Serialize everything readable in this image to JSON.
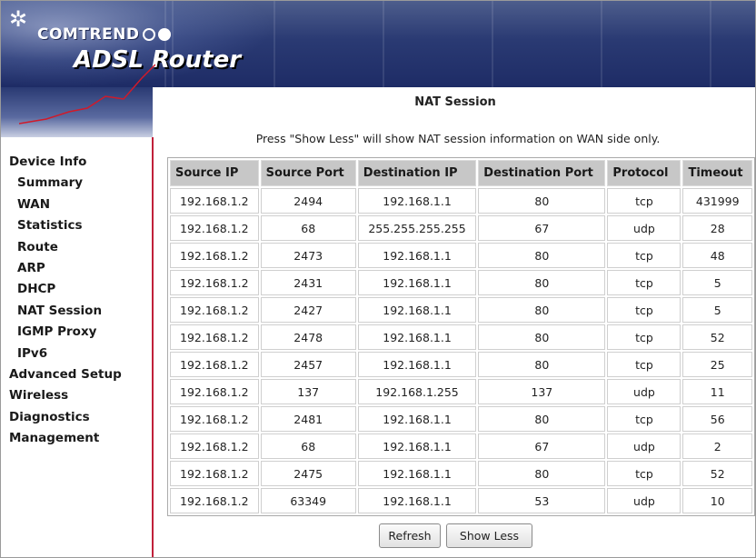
{
  "header": {
    "brand": "COMTREND",
    "product": "ADSL Router",
    "logo_icon": "snowflake-logo-icon"
  },
  "sidebar": {
    "items": [
      {
        "label": "Device Info",
        "level": "top"
      },
      {
        "label": "Summary",
        "level": "sub"
      },
      {
        "label": "WAN",
        "level": "sub"
      },
      {
        "label": "Statistics",
        "level": "sub"
      },
      {
        "label": "Route",
        "level": "sub"
      },
      {
        "label": "ARP",
        "level": "sub"
      },
      {
        "label": "DHCP",
        "level": "sub"
      },
      {
        "label": "NAT Session",
        "level": "sub"
      },
      {
        "label": "IGMP Proxy",
        "level": "sub"
      },
      {
        "label": "IPv6",
        "level": "sub"
      },
      {
        "label": "Advanced Setup",
        "level": "top"
      },
      {
        "label": "Wireless",
        "level": "top"
      },
      {
        "label": "Diagnostics",
        "level": "top"
      },
      {
        "label": "Management",
        "level": "top"
      }
    ]
  },
  "main": {
    "title": "NAT Session",
    "note": "Press \"Show Less\" will show NAT session information on WAN side only.",
    "table": {
      "headers": [
        "Source IP",
        "Source Port",
        "Destination IP",
        "Destination Port",
        "Protocol",
        "Timeout"
      ],
      "rows": [
        [
          "192.168.1.2",
          "2494",
          "192.168.1.1",
          "80",
          "tcp",
          "431999"
        ],
        [
          "192.168.1.2",
          "68",
          "255.255.255.255",
          "67",
          "udp",
          "28"
        ],
        [
          "192.168.1.2",
          "2473",
          "192.168.1.1",
          "80",
          "tcp",
          "48"
        ],
        [
          "192.168.1.2",
          "2431",
          "192.168.1.1",
          "80",
          "tcp",
          "5"
        ],
        [
          "192.168.1.2",
          "2427",
          "192.168.1.1",
          "80",
          "tcp",
          "5"
        ],
        [
          "192.168.1.2",
          "2478",
          "192.168.1.1",
          "80",
          "tcp",
          "52"
        ],
        [
          "192.168.1.2",
          "2457",
          "192.168.1.1",
          "80",
          "tcp",
          "25"
        ],
        [
          "192.168.1.2",
          "137",
          "192.168.1.255",
          "137",
          "udp",
          "11"
        ],
        [
          "192.168.1.2",
          "2481",
          "192.168.1.1",
          "80",
          "tcp",
          "56"
        ],
        [
          "192.168.1.2",
          "68",
          "192.168.1.1",
          "67",
          "udp",
          "2"
        ],
        [
          "192.168.1.2",
          "2475",
          "192.168.1.1",
          "80",
          "tcp",
          "52"
        ],
        [
          "192.168.1.2",
          "63349",
          "192.168.1.1",
          "53",
          "udp",
          "10"
        ]
      ]
    },
    "buttons": {
      "refresh": "Refresh",
      "show_less": "Show Less"
    }
  },
  "colors": {
    "banner": "#2a3a73",
    "sidebar_accent": "#c0203a",
    "table_header": "#c7c7c7"
  }
}
